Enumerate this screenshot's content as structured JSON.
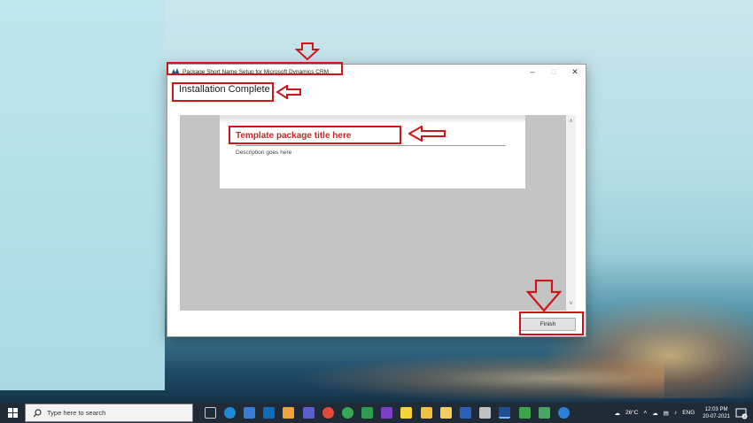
{
  "window": {
    "title": "Package Short Name Setup for Microsoft Dynamics CRM",
    "controls": {
      "minimize": "–",
      "maximize": "□",
      "close": "✕"
    },
    "heading": "Installation Complete",
    "package": {
      "title": "Template package title here",
      "description": "Description goes here"
    },
    "finish_label": "Finish"
  },
  "taskbar": {
    "search_placeholder": "Type here to search",
    "weather": "26°C",
    "language": "ENG",
    "time": "12:03 PM",
    "date": "20-07-2021",
    "notifications": "3"
  },
  "colors": {
    "annotation": "#d0151a",
    "package_title": "#c62828",
    "content_gray": "#c4c4c4",
    "taskbar": "#1f2b36"
  }
}
